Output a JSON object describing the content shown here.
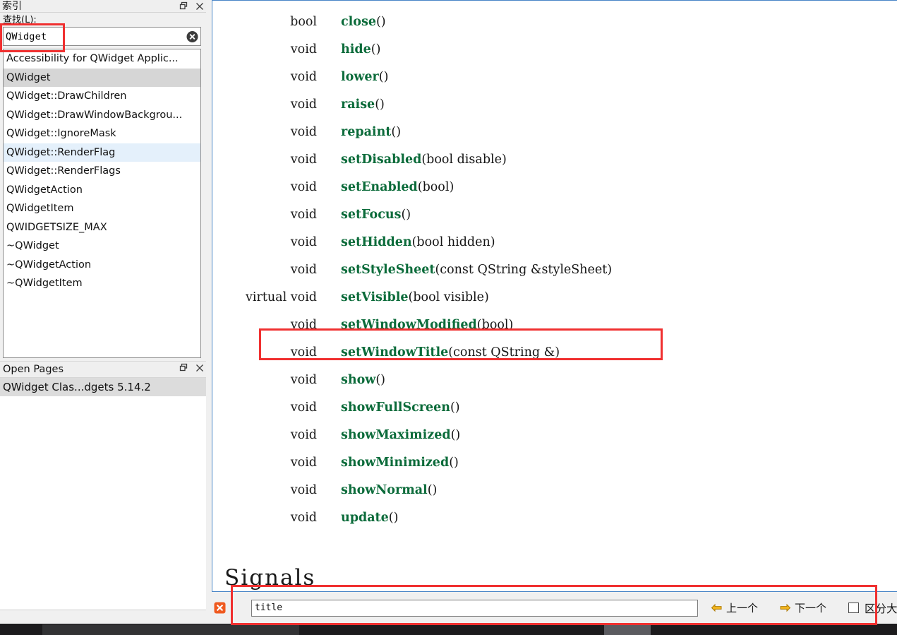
{
  "index_panel": {
    "title": "索引",
    "dock_icon": "float-icon",
    "close_icon": "close-icon",
    "find_label": "查找(L):",
    "search": {
      "value": "QWidget",
      "clear_icon": "clear-circle-icon"
    },
    "items": [
      {
        "label": "Accessibility for QWidget Applic...",
        "state": "normal"
      },
      {
        "label": "QWidget",
        "state": "selected"
      },
      {
        "label": "QWidget::DrawChildren",
        "state": "normal"
      },
      {
        "label": "QWidget::DrawWindowBackgrou...",
        "state": "normal"
      },
      {
        "label": "QWidget::IgnoreMask",
        "state": "normal"
      },
      {
        "label": "QWidget::RenderFlag",
        "state": "hover"
      },
      {
        "label": "QWidget::RenderFlags",
        "state": "normal"
      },
      {
        "label": "QWidgetAction",
        "state": "normal"
      },
      {
        "label": "QWidgetItem",
        "state": "normal"
      },
      {
        "label": "QWIDGETSIZE_MAX",
        "state": "normal"
      },
      {
        "label": "~QWidget",
        "state": "normal"
      },
      {
        "label": "~QWidgetAction",
        "state": "normal"
      },
      {
        "label": "~QWidgetItem",
        "state": "normal"
      }
    ]
  },
  "open_pages": {
    "title": "Open Pages",
    "dock_icon": "float-icon",
    "close_icon": "close-icon",
    "items": [
      {
        "label": "QWidget Clas...dgets 5.14.2"
      }
    ]
  },
  "document": {
    "functions": [
      {
        "ret": "bool",
        "name": "close",
        "args": "()"
      },
      {
        "ret": "void",
        "name": "hide",
        "args": "()"
      },
      {
        "ret": "void",
        "name": "lower",
        "args": "()"
      },
      {
        "ret": "void",
        "name": "raise",
        "args": "()"
      },
      {
        "ret": "void",
        "name": "repaint",
        "args": "()"
      },
      {
        "ret": "void",
        "name": "setDisabled",
        "args": "(bool ",
        "arg_italic": "disable",
        "args_tail": ")"
      },
      {
        "ret": "void",
        "name": "setEnabled",
        "args": "(",
        "arg_italic": "bool",
        "args_tail": ")"
      },
      {
        "ret": "void",
        "name": "setFocus",
        "args": "()"
      },
      {
        "ret": "void",
        "name": "setHidden",
        "args": "(bool ",
        "arg_italic": "hidden",
        "args_tail": ")"
      },
      {
        "ret": "void",
        "name": "setStyleSheet",
        "args": "(const QString &",
        "arg_italic": "styleSheet",
        "args_tail": ")"
      },
      {
        "ret": "virtual void",
        "name": "setVisible",
        "args": "(bool ",
        "arg_italic": "visible",
        "args_tail": ")"
      },
      {
        "ret": "void",
        "name": "setWindowModified",
        "args": "(",
        "arg_italic": "bool",
        "args_tail": ")"
      },
      {
        "ret": "void",
        "name": "setWindowTitle",
        "args": "(",
        "arg_italic": "const QString &",
        "args_tail": ")",
        "highlighted": true
      },
      {
        "ret": "void",
        "name": "show",
        "args": "()"
      },
      {
        "ret": "void",
        "name": "showFullScreen",
        "args": "()"
      },
      {
        "ret": "void",
        "name": "showMaximized",
        "args": "()"
      },
      {
        "ret": "void",
        "name": "showMinimized",
        "args": "()"
      },
      {
        "ret": "void",
        "name": "showNormal",
        "args": "()"
      },
      {
        "ret": "void",
        "name": "update",
        "args": "()"
      }
    ],
    "signals_heading": "Signals"
  },
  "find_bar": {
    "close_icon": "close-find-icon",
    "input_value": "title",
    "input_placeholder": "",
    "prev_label": "上一个",
    "prev_icon": "arrow-left-icon",
    "next_label": "下一个",
    "next_icon": "arrow-right-icon",
    "case_label": "区分大小写",
    "case_checked": false
  },
  "colors": {
    "annotation": "#f03030",
    "link_green": "#0b6b3a",
    "selection_gray": "#d6d6d6",
    "hover_blue": "#e4f0fb",
    "pane_border": "#4a86c8",
    "find_close_orange": "#ef5a20"
  }
}
